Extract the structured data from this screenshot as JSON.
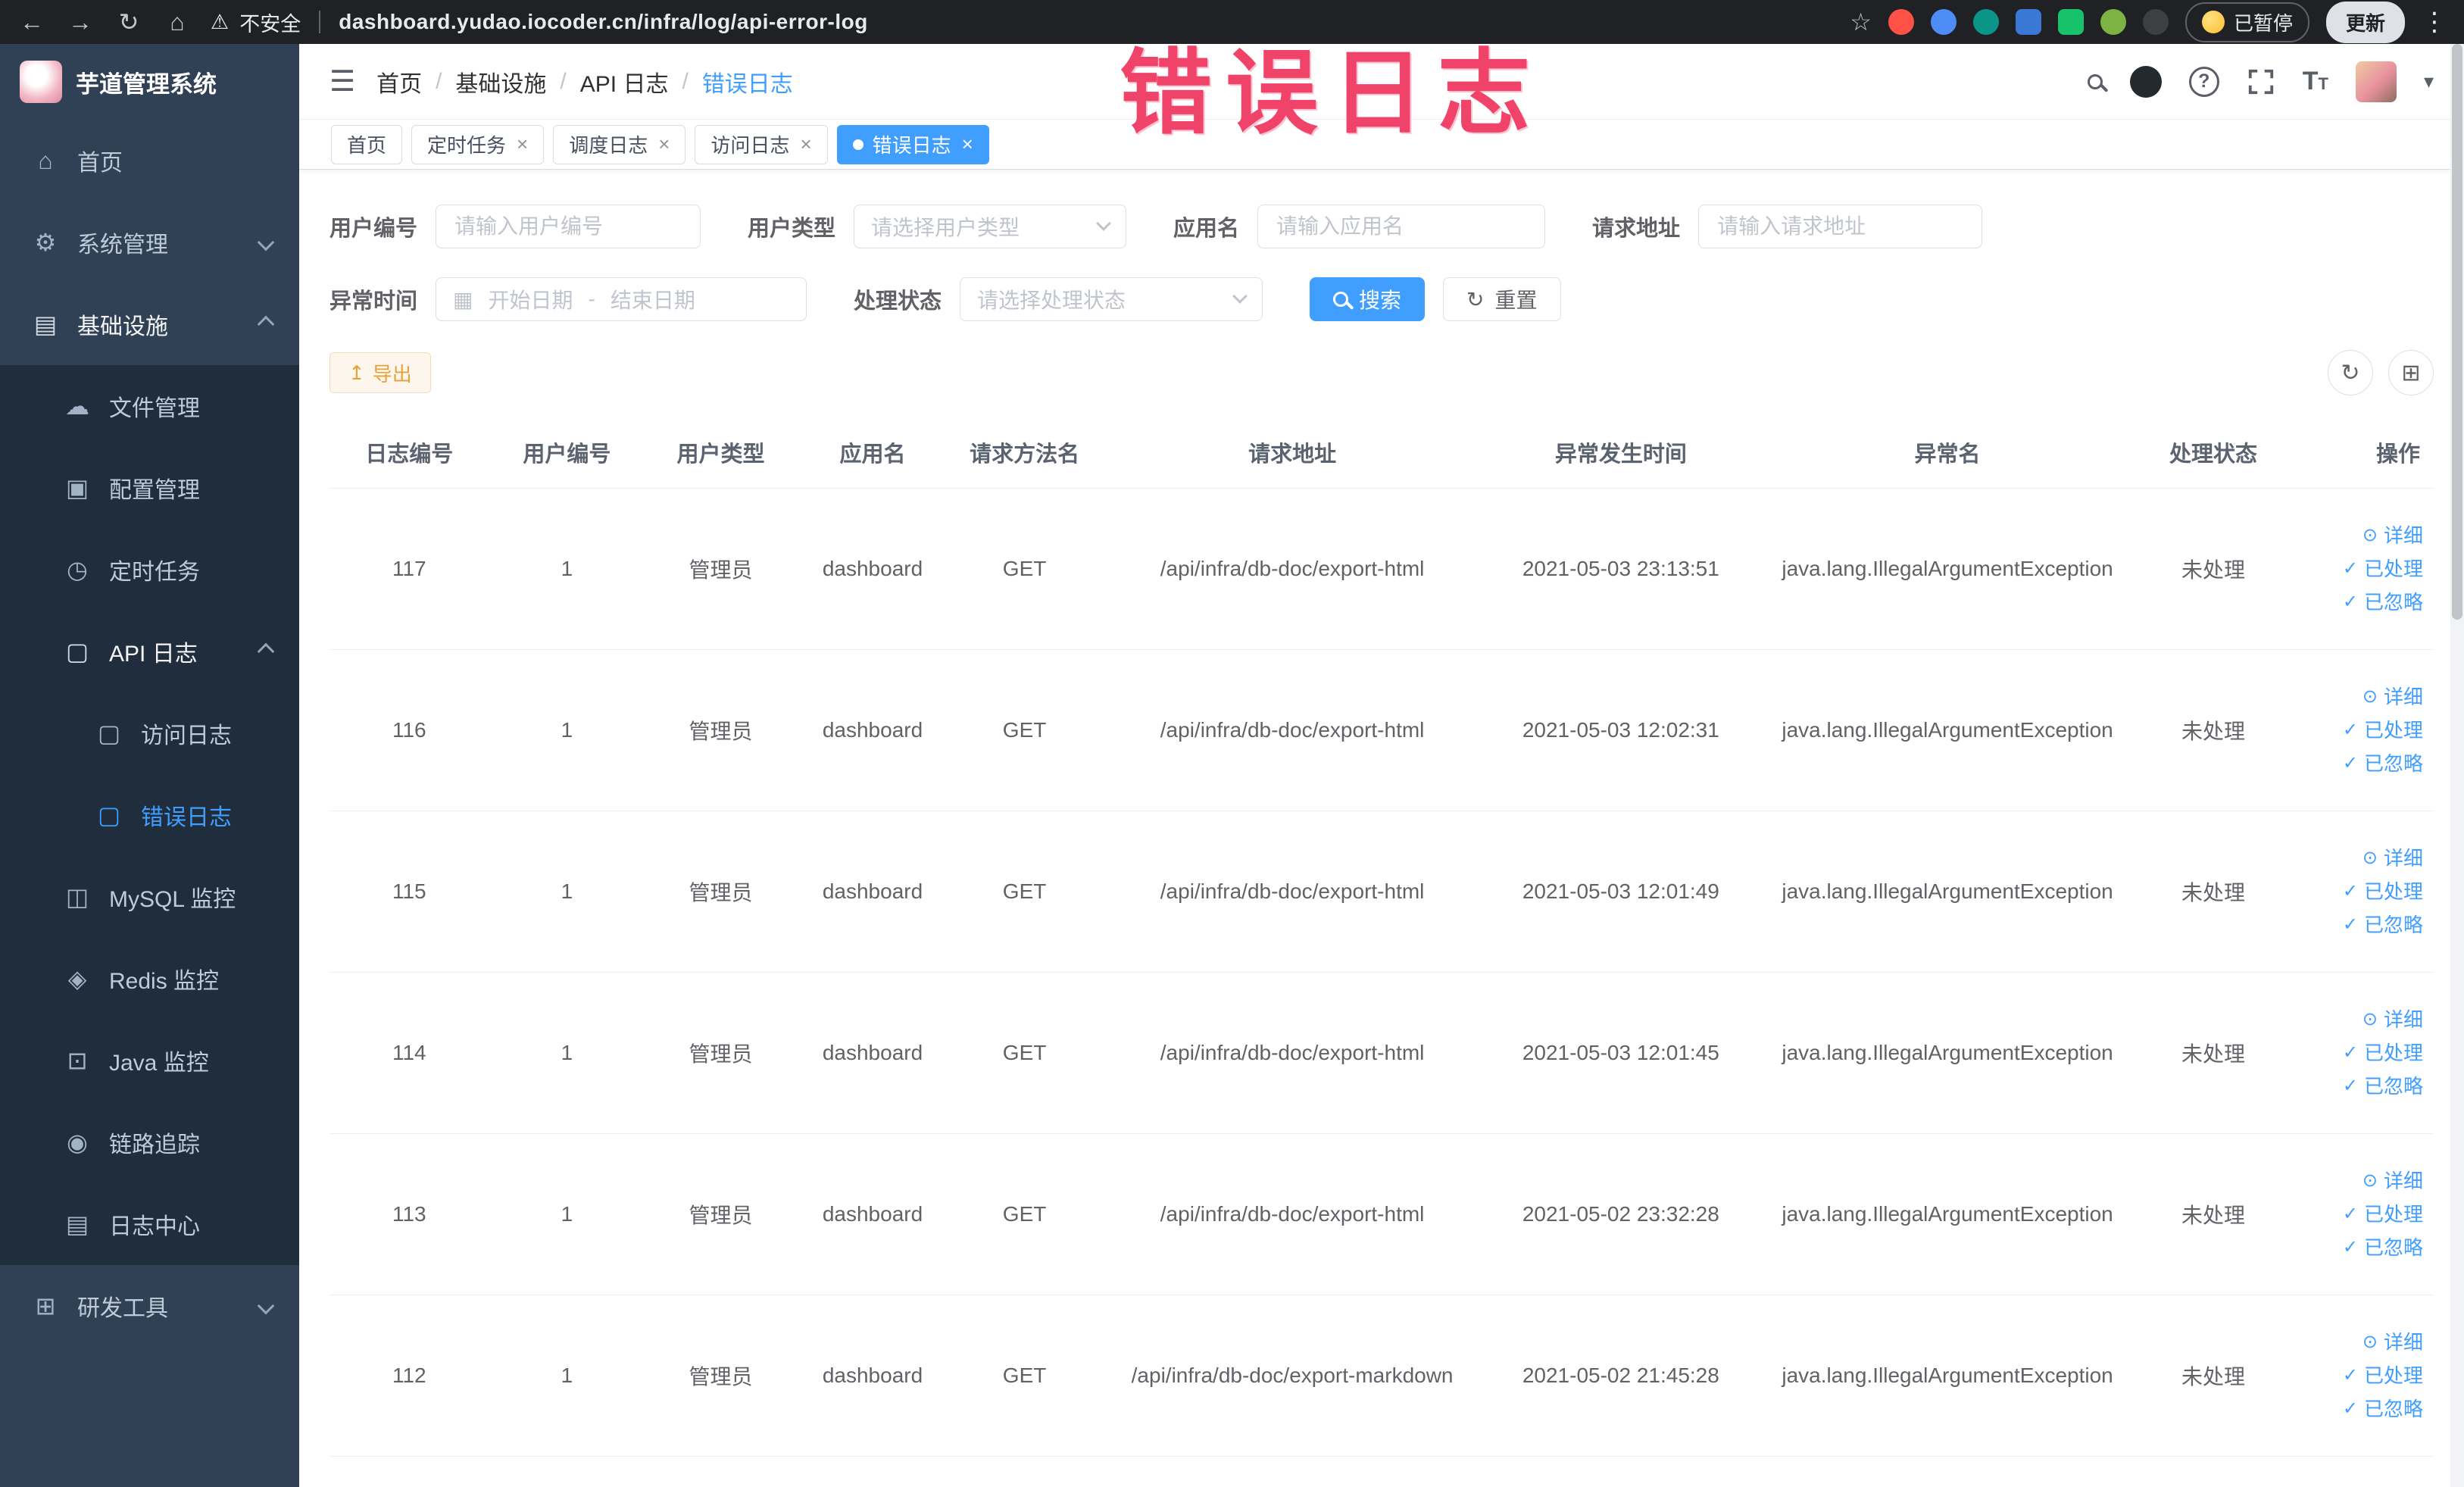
{
  "browser": {
    "security_label": "不安全",
    "url": "dashboard.yudao.iocoder.cn/infra/log/api-error-log",
    "paused_label": "已暂停",
    "update_label": "更新"
  },
  "annotation": {
    "text": "错误日志",
    "color": "#f0436a"
  },
  "sidebar": {
    "logo_title": "芋道管理系统",
    "items": [
      {
        "label": "首页"
      },
      {
        "label": "系统管理"
      },
      {
        "label": "基础设施"
      },
      {
        "label": "文件管理"
      },
      {
        "label": "配置管理"
      },
      {
        "label": "定时任务"
      },
      {
        "label": "API 日志"
      },
      {
        "label": "访问日志"
      },
      {
        "label": "错误日志"
      },
      {
        "label": "MySQL 监控"
      },
      {
        "label": "Redis 监控"
      },
      {
        "label": "Java 监控"
      },
      {
        "label": "链路追踪"
      },
      {
        "label": "日志中心"
      },
      {
        "label": "研发工具"
      }
    ]
  },
  "header": {
    "breadcrumb": [
      "首页",
      "基础设施",
      "API 日志",
      "错误日志"
    ]
  },
  "tabs": {
    "items": [
      {
        "label": "首页"
      },
      {
        "label": "定时任务"
      },
      {
        "label": "调度日志"
      },
      {
        "label": "访问日志"
      },
      {
        "label": "错误日志"
      }
    ]
  },
  "filters": {
    "user_id": {
      "label": "用户编号",
      "placeholder": "请输入用户编号"
    },
    "user_type": {
      "label": "用户类型",
      "placeholder": "请选择用户类型"
    },
    "app_name": {
      "label": "应用名",
      "placeholder": "请输入应用名"
    },
    "request_url": {
      "label": "请求地址",
      "placeholder": "请输入请求地址"
    },
    "exception_time": {
      "label": "异常时间",
      "start_placeholder": "开始日期",
      "separator": "-",
      "end_placeholder": "结束日期"
    },
    "process_status": {
      "label": "处理状态",
      "placeholder": "请选择处理状态"
    },
    "search_label": "搜索",
    "reset_label": "重置"
  },
  "toolbar": {
    "export_label": "导出"
  },
  "table": {
    "columns": [
      "日志编号",
      "用户编号",
      "用户类型",
      "应用名",
      "请求方法名",
      "请求地址",
      "异常发生时间",
      "异常名",
      "处理状态",
      "操作"
    ],
    "action_labels": [
      "详细",
      "已处理",
      "已忽略"
    ],
    "rows": [
      {
        "id": "117",
        "user_id": "1",
        "user_type": "管理员",
        "app": "dashboard",
        "method": "GET",
        "url": "/api/infra/db-doc/export-html",
        "time": "2021-05-03 23:13:51",
        "exception": "java.lang.IllegalArgumentException",
        "status": "未处理"
      },
      {
        "id": "116",
        "user_id": "1",
        "user_type": "管理员",
        "app": "dashboard",
        "method": "GET",
        "url": "/api/infra/db-doc/export-html",
        "time": "2021-05-03 12:02:31",
        "exception": "java.lang.IllegalArgumentException",
        "status": "未处理"
      },
      {
        "id": "115",
        "user_id": "1",
        "user_type": "管理员",
        "app": "dashboard",
        "method": "GET",
        "url": "/api/infra/db-doc/export-html",
        "time": "2021-05-03 12:01:49",
        "exception": "java.lang.IllegalArgumentException",
        "status": "未处理"
      },
      {
        "id": "114",
        "user_id": "1",
        "user_type": "管理员",
        "app": "dashboard",
        "method": "GET",
        "url": "/api/infra/db-doc/export-html",
        "time": "2021-05-03 12:01:45",
        "exception": "java.lang.IllegalArgumentException",
        "status": "未处理"
      },
      {
        "id": "113",
        "user_id": "1",
        "user_type": "管理员",
        "app": "dashboard",
        "method": "GET",
        "url": "/api/infra/db-doc/export-html",
        "time": "2021-05-02 23:32:28",
        "exception": "java.lang.IllegalArgumentException",
        "status": "未处理"
      },
      {
        "id": "112",
        "user_id": "1",
        "user_type": "管理员",
        "app": "dashboard",
        "method": "GET",
        "url": "/api/infra/db-doc/export-markdown",
        "time": "2021-05-02 21:45:28",
        "exception": "java.lang.IllegalArgumentException",
        "status": "未处理"
      }
    ]
  },
  "icons": {
    "back": "←",
    "forward": "→",
    "reload": "↻",
    "home": "⌂",
    "warning": "⚠",
    "star": "☆",
    "kebab": "⋮",
    "menu_home": "⌂",
    "gear": "⚙",
    "infra": "▤",
    "cloud": "☁",
    "config": "▣",
    "timer": "◷",
    "doc": "▢",
    "mysql": "◫",
    "redis": "◈",
    "java": "⊡",
    "trace": "◉",
    "logcenter": "▤",
    "tools": "⊞",
    "hamburger": "☰",
    "help": "?",
    "caret": "▾",
    "calendar": "▦",
    "refresh": "↻",
    "columns": "⊞",
    "export": "↥",
    "eye": "⊙",
    "check": "✓",
    "close": "×"
  },
  "colors": {
    "primary": "#409eff",
    "warning": "#e6a23c",
    "annotation": "#f0436a",
    "sidebar_bg": "#304156",
    "submenu_bg": "#1f2d3d"
  }
}
